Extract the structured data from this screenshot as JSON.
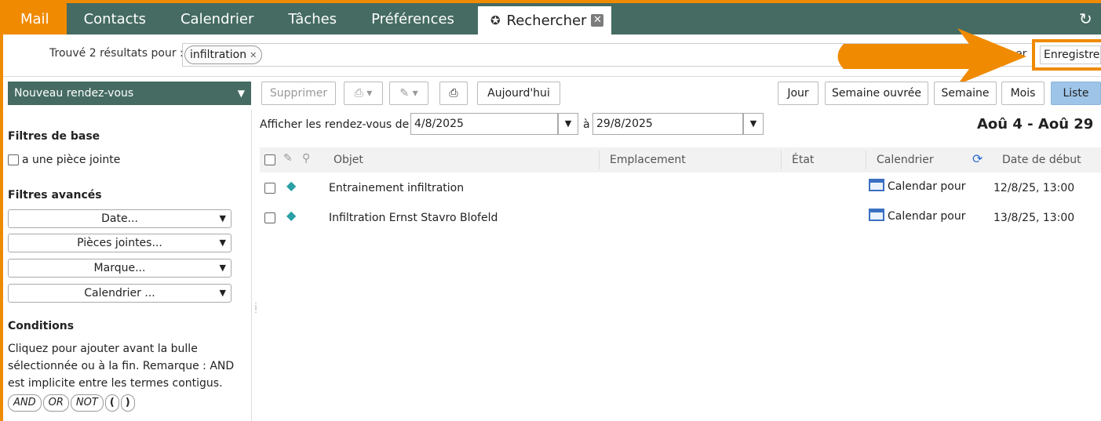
{
  "tabs": [
    {
      "label": "Mail"
    },
    {
      "label": "Contacts"
    },
    {
      "label": "Calendrier"
    },
    {
      "label": "Tâches"
    },
    {
      "label": "Préférences"
    },
    {
      "label": "Rechercher"
    }
  ],
  "results": {
    "label": "Trouvé 2 résultats pour :",
    "bubble": "infiltration",
    "save_hidden": "er",
    "save_label": "Enregistrer"
  },
  "toolbar": {
    "new_appt": "Nouveau rendez-vous",
    "delete": "Supprimer",
    "today": "Aujourd'hui",
    "day": "Jour",
    "workweek": "Semaine ouvrée",
    "week": "Semaine",
    "month": "Mois",
    "list": "Liste"
  },
  "filters": {
    "basic_title": "Filtres de base",
    "attachment_checkbox": "a une pièce jointe",
    "advanced_title": "Filtres avancés",
    "advanced": [
      "Date...",
      "Pièces jointes...",
      "Marque...",
      "Calendrier ..."
    ],
    "conditions_title": "Conditions",
    "conditions_text": "Cliquez pour ajouter avant la bulle sélectionnée ou à la fin. Remarque : AND est implicite entre les termes contigus.",
    "operators": [
      "AND",
      "OR",
      "NOT",
      "(",
      ")"
    ]
  },
  "range": {
    "label": "Afficher les rendez-vous de",
    "from": "4/8/2025",
    "to_label": "à",
    "to": "29/8/2025",
    "title": "Aoû 4 - Aoû 29"
  },
  "grid": {
    "columns": [
      "Objet",
      "Emplacement",
      "État",
      "Calendrier",
      "Date de début"
    ],
    "rows": [
      {
        "subject": "Entrainement infiltration",
        "location": "",
        "status": "",
        "calendar": "Calendar pour",
        "start": "12/8/25, 13:00"
      },
      {
        "subject": "Infiltration Ernst Stavro Blofeld",
        "location": "",
        "status": "",
        "calendar": "Calendar pour",
        "start": "13/8/25, 13:00"
      }
    ]
  },
  "colors": {
    "accent": "#f08a00",
    "header": "#456b62",
    "list_active": "#9ec5e8"
  }
}
